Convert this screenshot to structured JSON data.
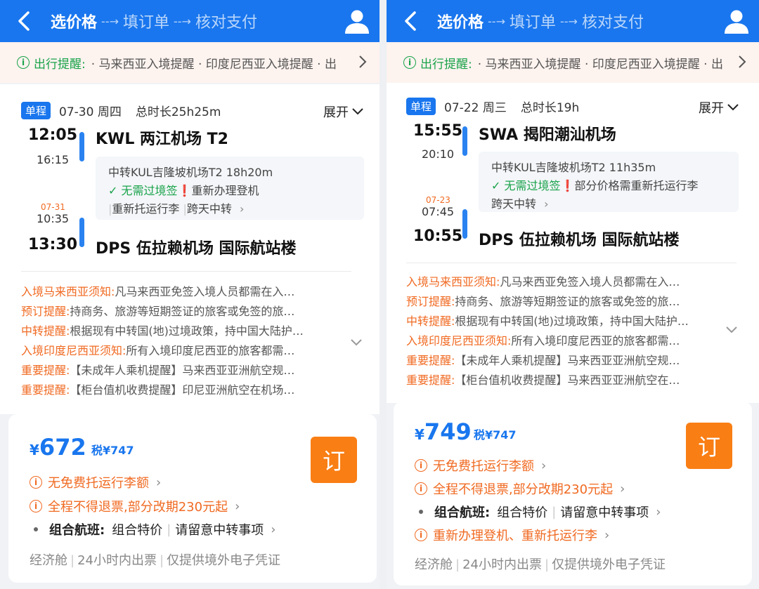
{
  "panels": [
    {
      "header": {
        "step_current": "选价格",
        "step_2": "填订单",
        "step_3": "核对支付",
        "arrow": "--→"
      },
      "notice": {
        "label": "出行提醒:",
        "text": "· 马来西亚入境提醒 · 印度尼西亚入境提醒 · 出"
      },
      "flight": {
        "badge": "单程",
        "date": "07-30 周四",
        "duration": "总时长25h25m",
        "expand": "展开",
        "dep_time": "12:05",
        "dep_airport": "KWL 两江机场 T2",
        "layover_arr_time": "16:15",
        "transfer_title": "中转KUL吉隆坡机场T2 18h20m",
        "transfer_ok": "无需过境签",
        "transfer_mark": "❗",
        "transfer_note1": "重新办理登机",
        "transfer_note2": "重新托运行李",
        "transfer_note3": "跨天中转",
        "layover_dep_date": "07-31",
        "layover_dep_time": "10:35",
        "arr_time": "13:30",
        "arr_airport": "DPS 伍拉赖机场 国际航站楼"
      },
      "tips": [
        {
          "k": "入境马来西亚须知:",
          "v": "凡马来西亚免签入境人员都需在入…"
        },
        {
          "k": "预订提醒:",
          "v": "持商务、旅游等短期签证的旅客或免签的旅…"
        },
        {
          "k": "中转提醒:",
          "v": "根据现有中转国(地)过境政策，持中国大陆护…"
        },
        {
          "k": "入境印度尼西亚须知:",
          "v": "所有入境印度尼西亚的旅客都需…"
        },
        {
          "k": "重要提醒:",
          "v": "【未成年人乘机提醒】马来西亚亚洲航空规…"
        },
        {
          "k": "重要提醒:",
          "v": "【柜台值机收费提醒】印尼亚洲航空在机场…"
        }
      ],
      "price": {
        "currency": "¥",
        "amount": "672",
        "tax": "税¥747",
        "book": "订",
        "line1": "无免费托运行李额",
        "line2": "全程不得退票,部分改期230元起",
        "combo_label": "组合航班:",
        "combo_v1": "组合特价",
        "combo_v2": "请留意中转事项",
        "extra": "",
        "foot1": "经济舱",
        "foot2": "24小时内出票",
        "foot3": "仅提供境外电子凭证"
      }
    },
    {
      "header": {
        "step_current": "选价格",
        "step_2": "填订单",
        "step_3": "核对支付",
        "arrow": "--→"
      },
      "notice": {
        "label": "出行提醒:",
        "text": "· 马来西亚入境提醒 · 印度尼西亚入境提醒 · 出"
      },
      "flight": {
        "badge": "单程",
        "date": "07-22 周三",
        "duration": "总时长19h",
        "expand": "展开",
        "dep_time": "15:55",
        "dep_airport": "SWA 揭阳潮汕机场",
        "layover_arr_time": "20:10",
        "transfer_title": "中转KUL吉隆坡机场T2 11h35m",
        "transfer_ok": "无需过境签",
        "transfer_mark": "❗",
        "transfer_note1": "部分价格需重新托运行李",
        "transfer_note2": "跨天中转",
        "transfer_note3": "",
        "layover_dep_date": "07-23",
        "layover_dep_time": "07:45",
        "arr_time": "10:55",
        "arr_airport": "DPS 伍拉赖机场 国际航站楼"
      },
      "tips": [
        {
          "k": "入境马来西亚须知:",
          "v": "凡马来西亚免签入境人员都需在入…"
        },
        {
          "k": "预订提醒:",
          "v": "持商务、旅游等短期签证的旅客或免签的旅…"
        },
        {
          "k": "中转提醒:",
          "v": "根据现有中转国(地)过境政策，持中国大陆护…"
        },
        {
          "k": "入境印度尼西亚须知:",
          "v": "所有入境印度尼西亚的旅客都需…"
        },
        {
          "k": "重要提醒:",
          "v": "【未成年人乘机提醒】马来西亚亚洲航空规…"
        },
        {
          "k": "重要提醒:",
          "v": "【柜台值机收费提醒】马来西亚亚洲航空在…"
        }
      ],
      "price": {
        "currency": "¥",
        "amount": "749",
        "tax": "税¥747",
        "book": "订",
        "line1": "无免费托运行李额",
        "line2": "全程不得退票,部分改期230元起",
        "combo_label": "组合航班:",
        "combo_v1": "组合特价",
        "combo_v2": "请留意中转事项",
        "extra": "重新办理登机、重新托运行李",
        "foot1": "经济舱",
        "foot2": "24小时内出票",
        "foot3": "仅提供境外电子凭证"
      }
    }
  ]
}
